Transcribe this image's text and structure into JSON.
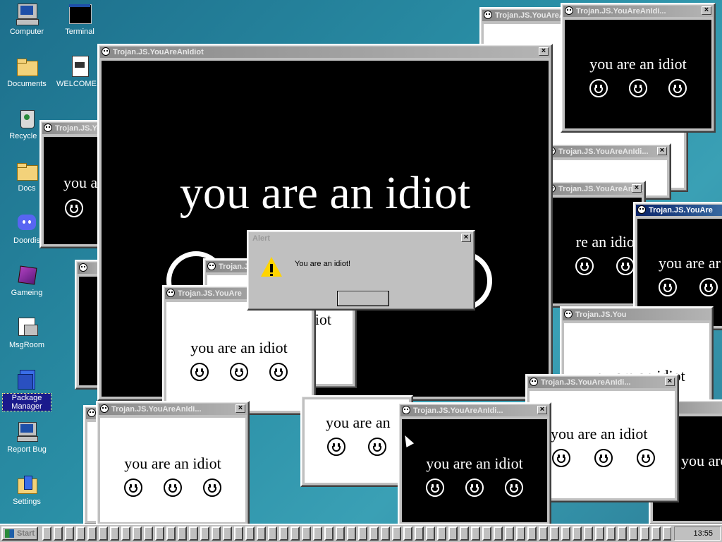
{
  "desktop": {
    "icons": [
      {
        "label": "Computer"
      },
      {
        "label": "Terminal"
      },
      {
        "label": "Documents"
      },
      {
        "label": "WELCOME..."
      },
      {
        "label": "Recycle B"
      },
      {
        "label": "Docs"
      },
      {
        "label": "Doordis"
      },
      {
        "label": "Gameing"
      },
      {
        "label": "MsgRoom"
      },
      {
        "label": "Package Manager"
      },
      {
        "label": "Report Bug"
      },
      {
        "label": "Settings"
      }
    ]
  },
  "windows": {
    "title": "Trojan.JS.YouAreAnIdiot",
    "title_truncated": "Trojan.JS.YouAreAnIdi...",
    "title_short": "Trojan.JS.YouAre",
    "title_tiny": "Trojan.JS.You",
    "message": "you are an idiot",
    "message_partial_a": "you a",
    "message_partial_b": "you are an",
    "message_partial_c": "re an idiot",
    "message_partial_d": "you are ar",
    "message_partial_e": "you are an idiot",
    "message_partial_f": "iot"
  },
  "alert": {
    "title": "Alert",
    "message": "You are an idiot!",
    "ok_label": ""
  },
  "taskbar": {
    "start_label": "Start",
    "clock": "13:55"
  },
  "colors": {
    "desktop": "#2a8fa6",
    "titlebar_active": "#0a246a"
  }
}
